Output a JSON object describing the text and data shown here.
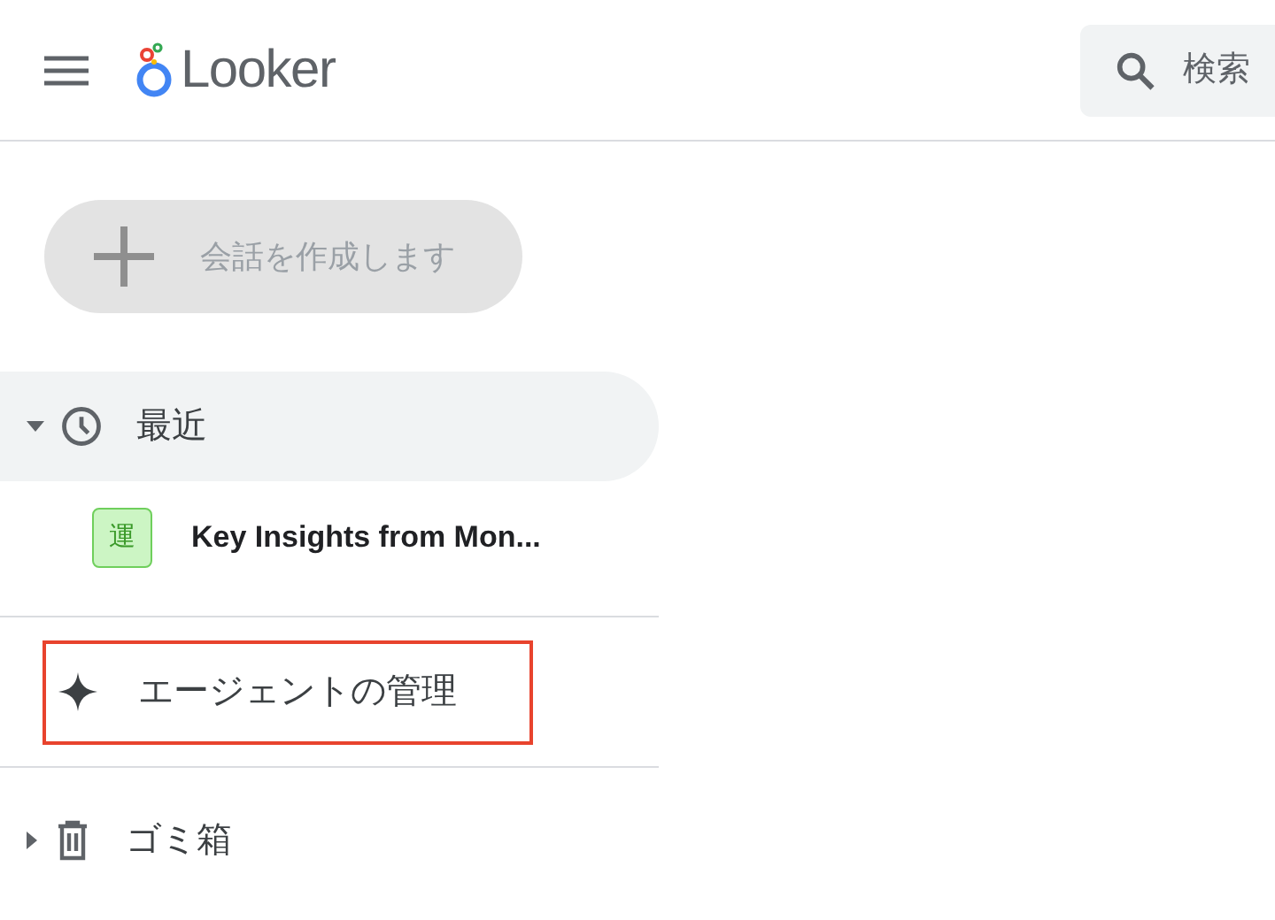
{
  "header": {
    "logo_text": "Looker",
    "search": {
      "placeholder": "検索"
    }
  },
  "new_button": {
    "label": "会話を作成します",
    "disabled": true
  },
  "sections": [
    {
      "kind": "folder",
      "label": "最近",
      "expanded": true,
      "selected": true,
      "children": [
        {
          "label": "Key Insights from Mon...",
          "badge": "運"
        }
      ]
    },
    {
      "kind": "link",
      "label": "エージェントの管理",
      "highlighted": true
    },
    {
      "kind": "folder",
      "label": "ゴミ箱",
      "expanded": false,
      "selected": false
    }
  ]
}
